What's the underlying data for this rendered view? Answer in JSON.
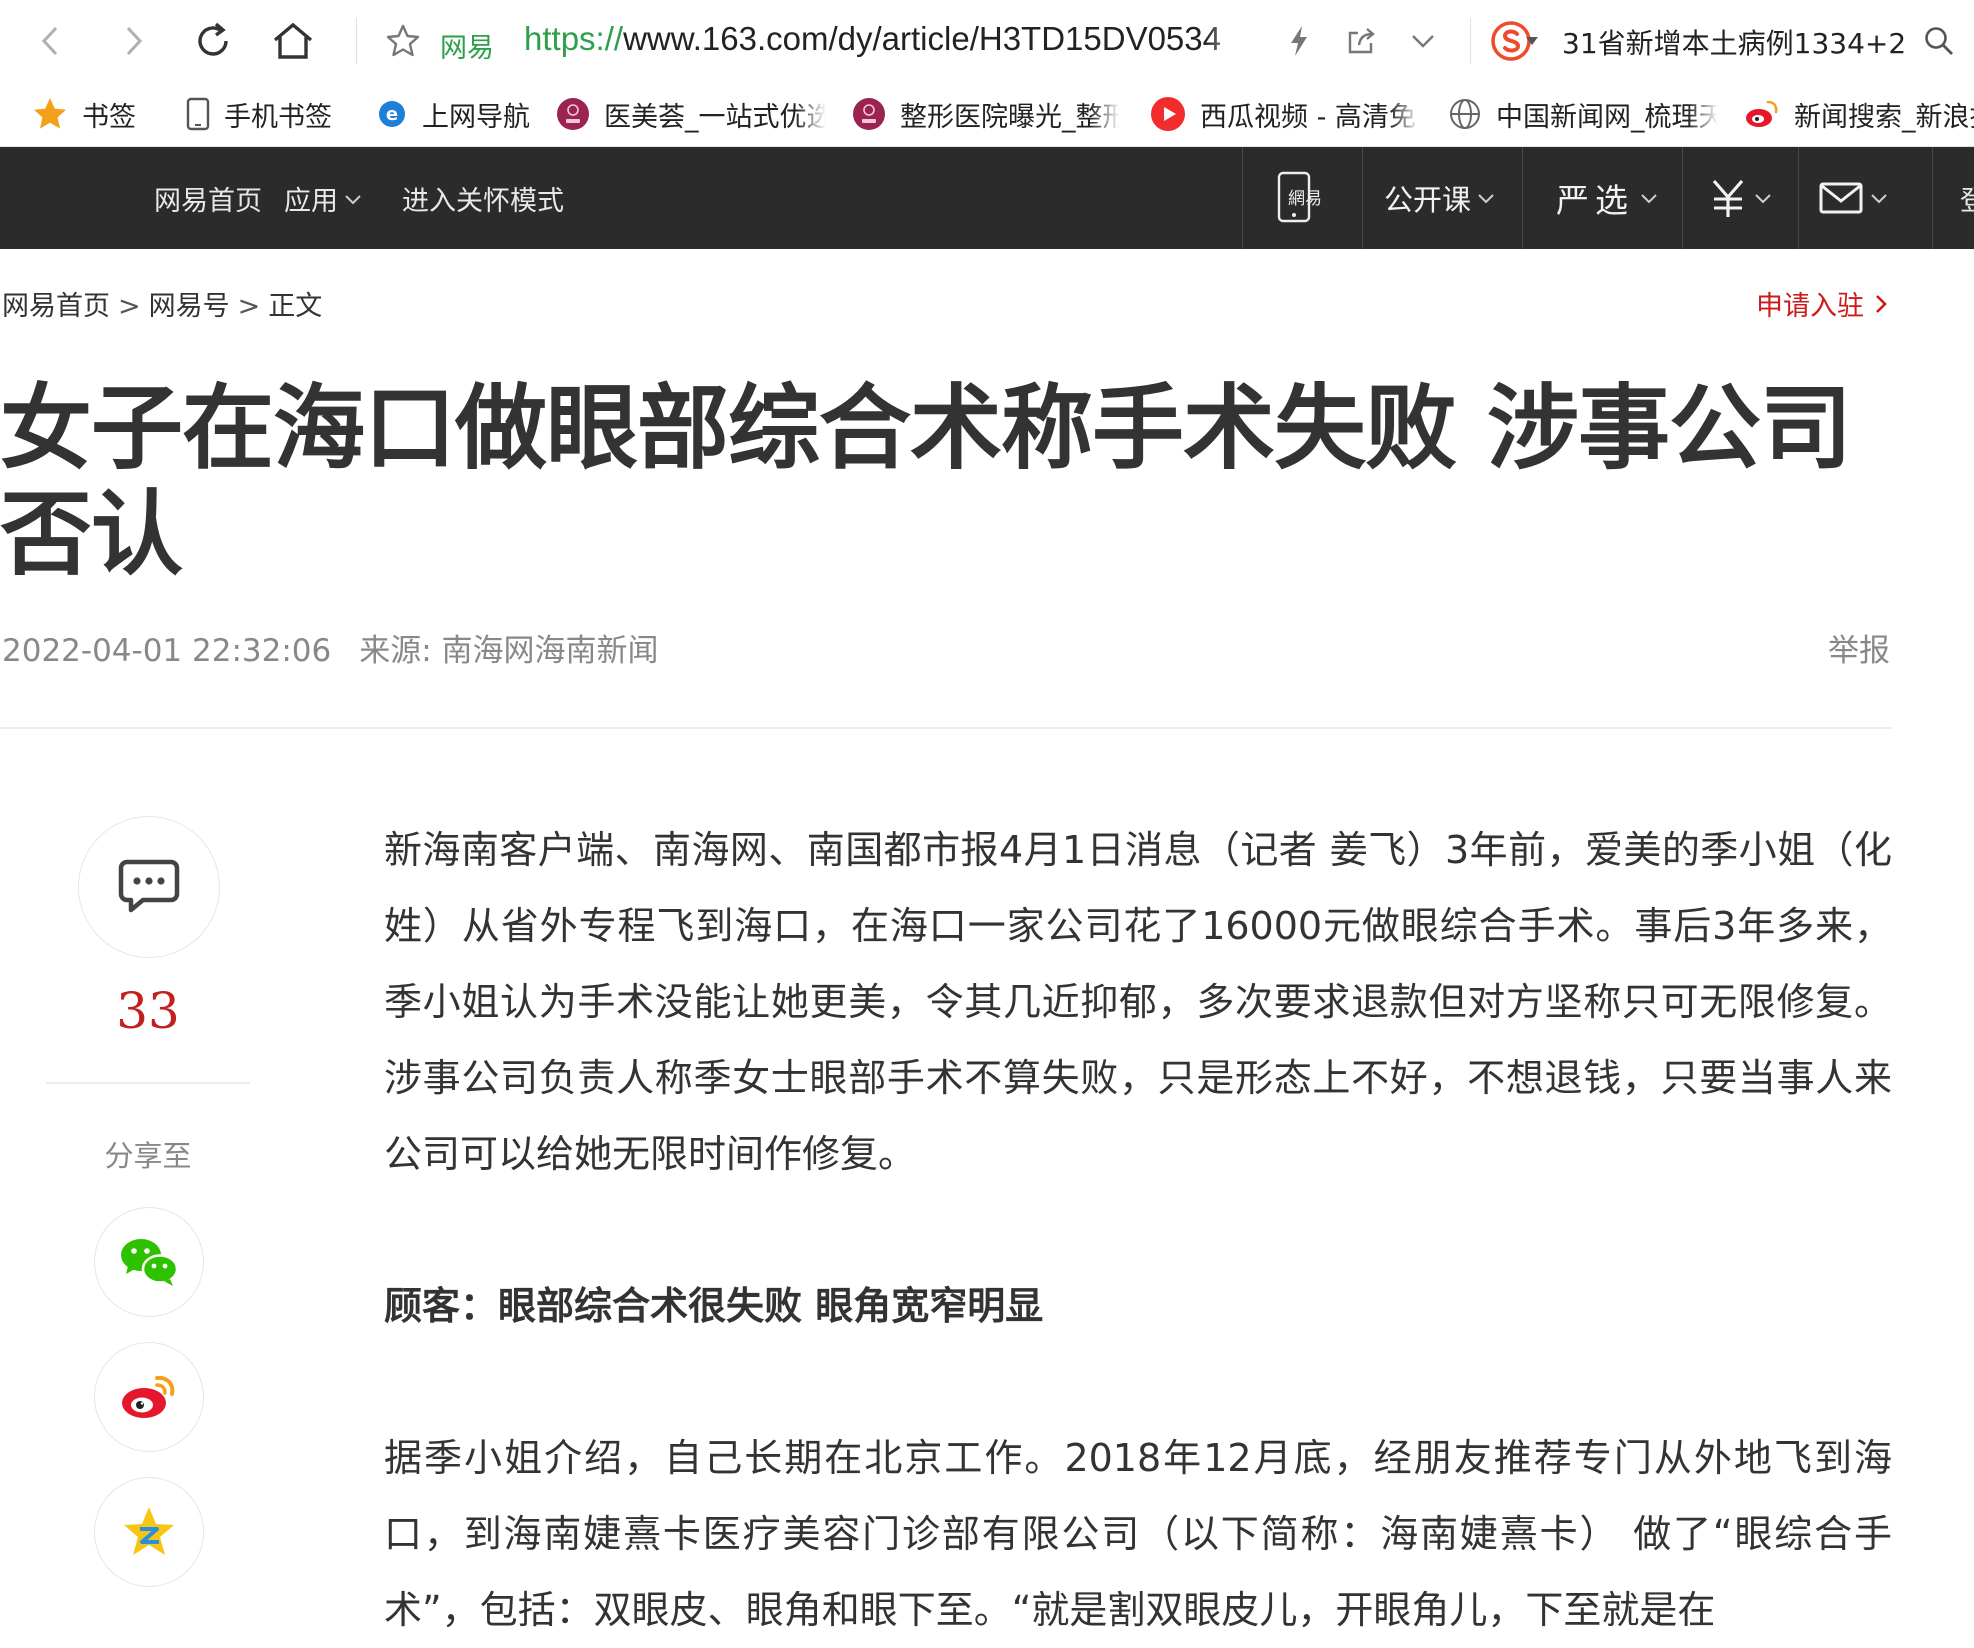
{
  "browser": {
    "site_name": "网易",
    "url_scheme": "https://",
    "url_rest": "www.163.com/dy/article/H3TD15DV0534",
    "search_text": "31省新增本土病例1334+2"
  },
  "bookmarks": [
    {
      "label": "书签",
      "icon": "star-icon"
    },
    {
      "label": "手机书签",
      "icon": "phone-icon"
    },
    {
      "label": "上网导航",
      "icon": "ie-icon"
    },
    {
      "label": "医美荟_一站式优选",
      "icon": "yimeihui-icon"
    },
    {
      "label": "整形医院曝光_整形",
      "icon": "yimeihui-icon"
    },
    {
      "label": "西瓜视频 - 高清免",
      "icon": "xigua-icon"
    },
    {
      "label": "中国新闻网_梳理天",
      "icon": "globe-icon"
    },
    {
      "label": "新闻搜索_新浪搜",
      "icon": "weibo-icon"
    }
  ],
  "topnav": {
    "home": "网易首页",
    "apps": "应用",
    "care_mode": "进入关怀模式",
    "open_course": "公开课",
    "yanxuan": "严选",
    "partial": "登"
  },
  "breadcrumb": {
    "items": [
      "网易首页",
      "网易号",
      "正文"
    ],
    "separator": ">"
  },
  "apply_label": "申请入驻",
  "article": {
    "title": "女子在海口做眼部综合术称手术失败 涉事公司否认",
    "datetime": "2022-04-01 22:32:06",
    "source": "来源: 南海网海南新闻",
    "report": "举报",
    "paragraphs": [
      "新海南客户端、南海网、南国都市报4月1日消息（记者 姜飞）3年前，爱美的季小姐（化姓）从省外专程飞到海口，在海口一家公司花了16000元做眼综合手术。事后3年多来，季小姐认为手术没能让她更美，令其几近抑郁，多次要求退款但对方坚称只可无限修复。涉事公司负责人称季女士眼部手术不算失败，只是形态上不好，不想退钱，只要当事人来公司可以给她无限时间作修复。",
      "顾客：眼部综合术很失败 眼角宽窄明显",
      "据季小姐介绍，自己长期在北京工作。2018年12月底，经朋友推荐专门从外地飞到海口，到海南婕熹卡医疗美容门诊部有限公司（以下简称：海南婕熹卡） 做了“眼综合手术”，包括：双眼皮、眼角和眼下至。“就是割双眼皮儿，开眼角儿，下至就是在"
    ]
  },
  "rail": {
    "comment_count": "33",
    "share_label": "分享至"
  },
  "colors": {
    "nav_bg": "#2b2b2b",
    "accent_red": "#cc1b1b",
    "site_green": "#2e9f4a",
    "wechat_green": "#2dc100",
    "weibo_red": "#e6162d",
    "qzone_yellow": "#f7c614"
  }
}
